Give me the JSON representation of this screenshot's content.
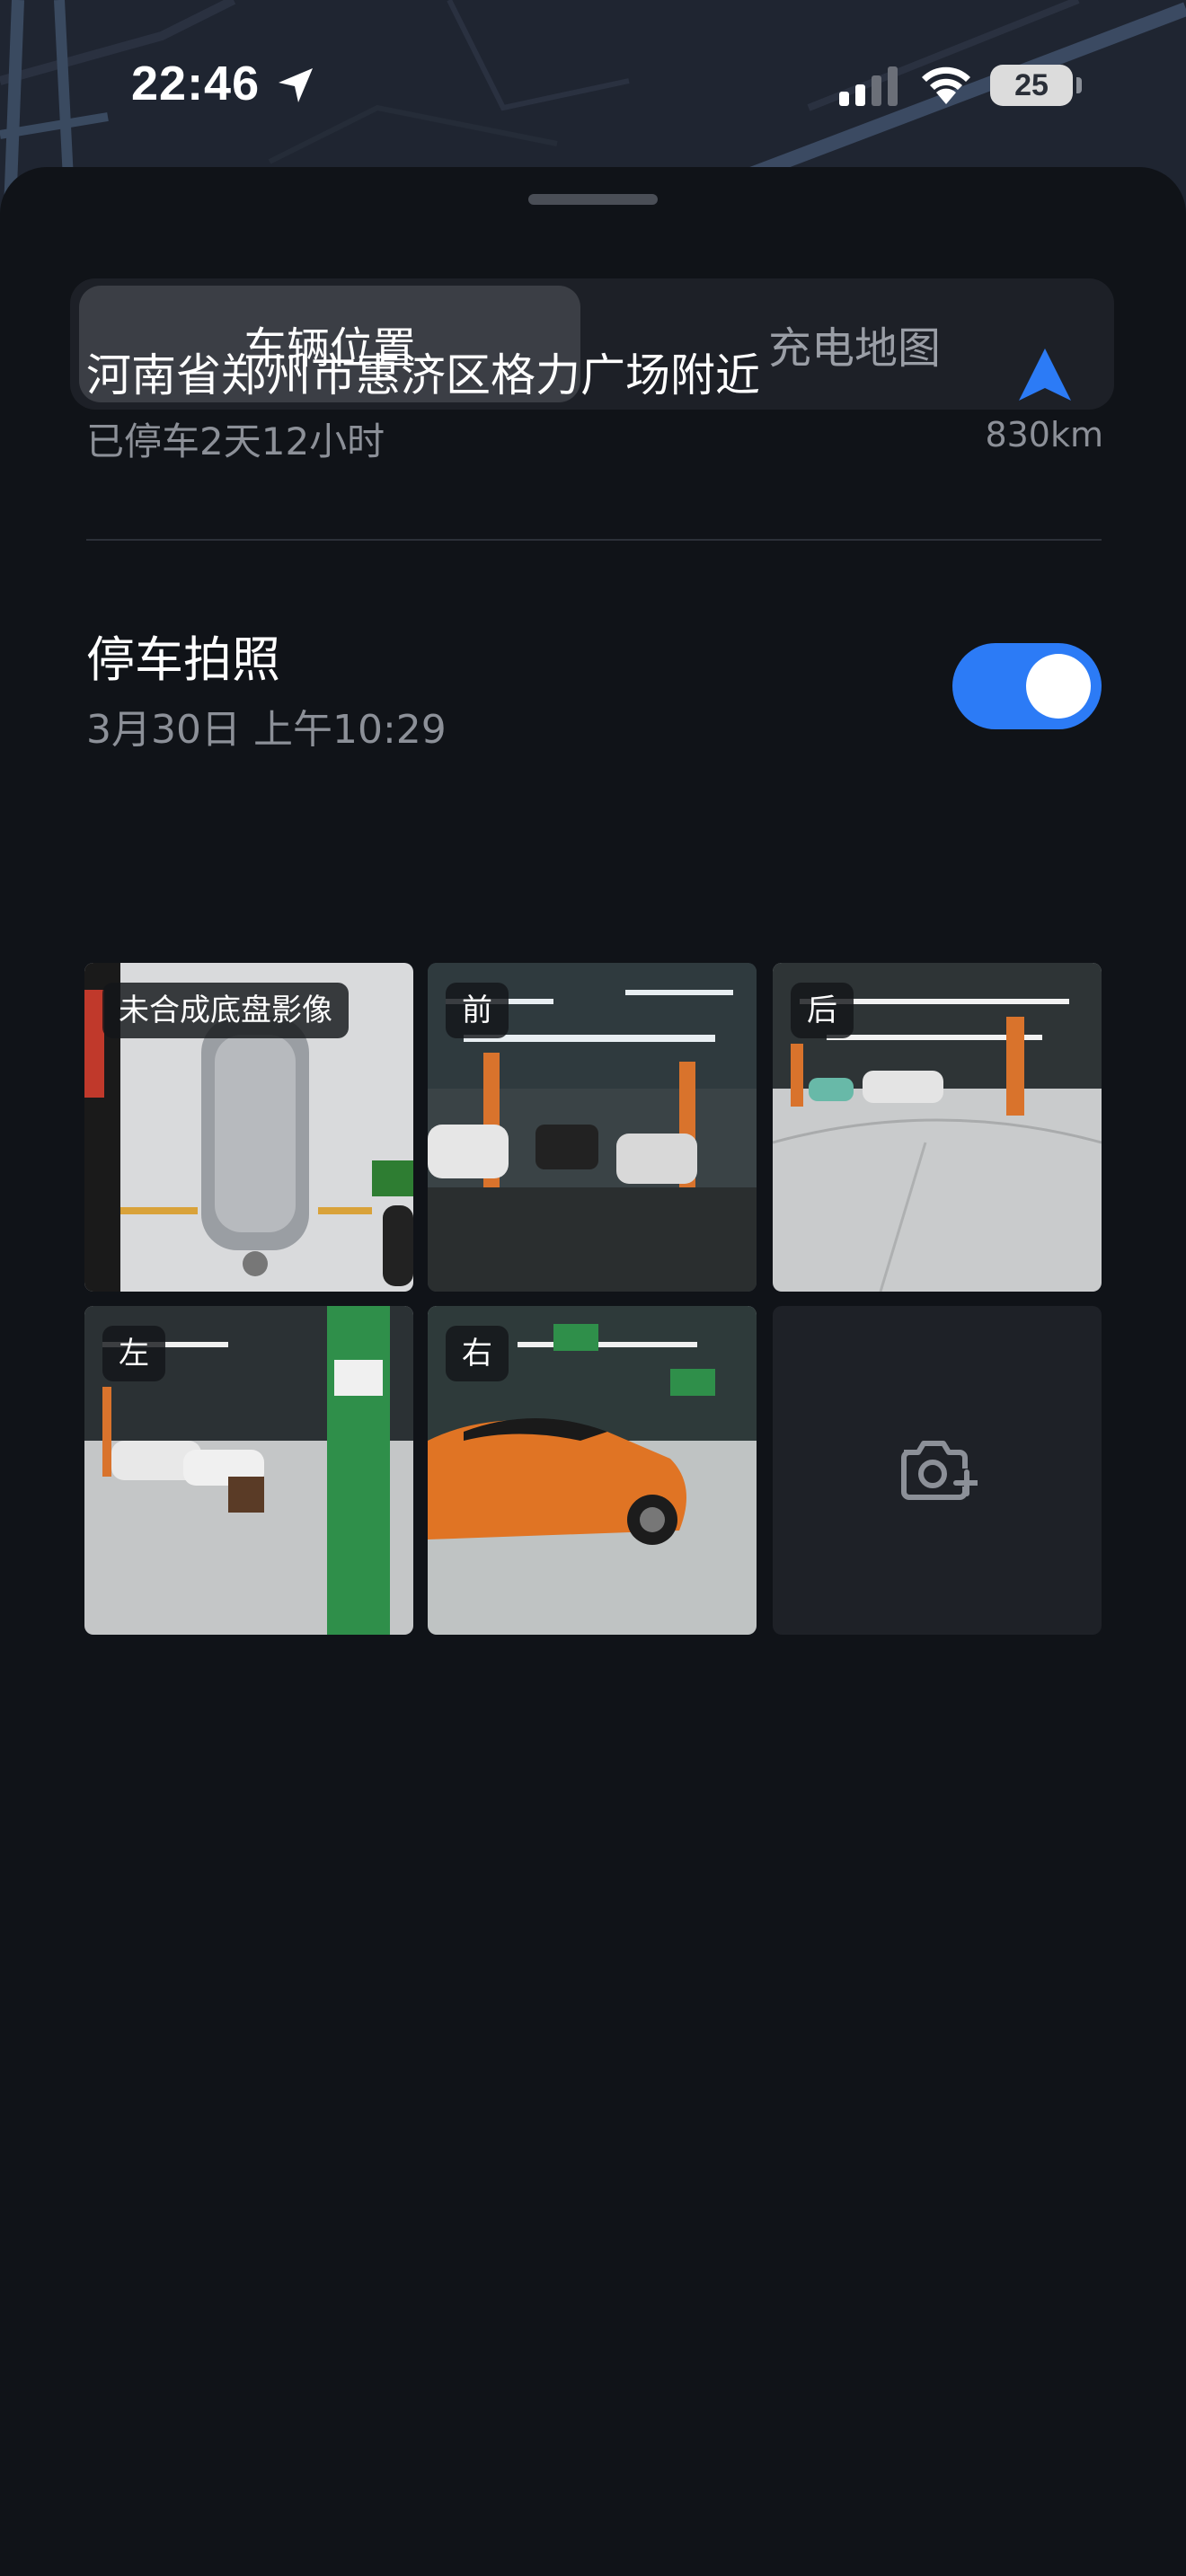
{
  "status_bar": {
    "time": "22:46",
    "battery": "25",
    "icons": [
      "location-arrow-icon",
      "signal-icon",
      "wifi-icon",
      "battery-icon"
    ]
  },
  "tabs": [
    {
      "label": "车辆位置",
      "active": true
    },
    {
      "label": "充电地图",
      "active": false
    }
  ],
  "location": {
    "address": "河南省郑州市惠济区格力广场附近",
    "parked_duration": "已停车2天12小时",
    "distance": "830km",
    "nav_icon": "navigation-arrow-icon"
  },
  "parking_photo": {
    "title": "停车拍照",
    "time": "3月30日 上午10:29",
    "enabled": true
  },
  "photos": [
    {
      "label": "未合成底盘影像"
    },
    {
      "label": "前"
    },
    {
      "label": "后"
    },
    {
      "label": "左"
    },
    {
      "label": "右"
    }
  ],
  "add_photo_icon": "camera-add-icon",
  "colors": {
    "accent": "#2c7bf6",
    "background": "#101318"
  }
}
